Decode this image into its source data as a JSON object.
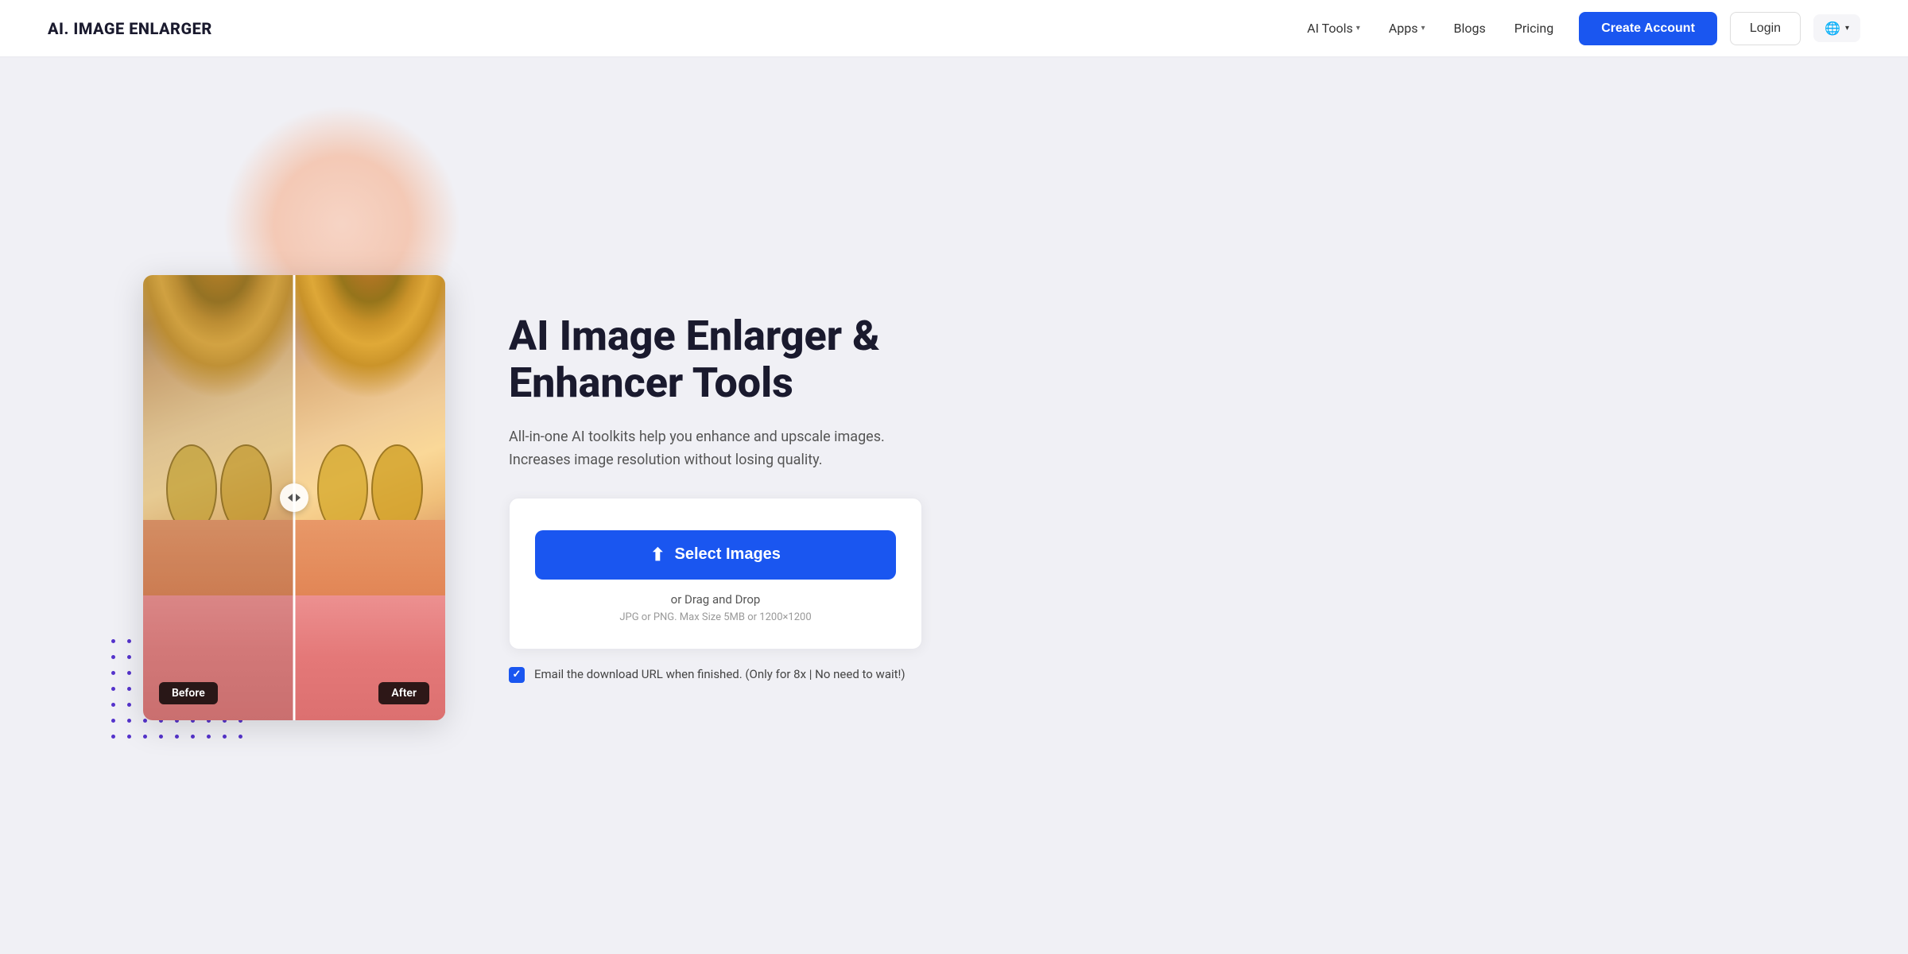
{
  "nav": {
    "logo": "AI. IMAGE ENLARGER",
    "links": [
      {
        "label": "AI Tools",
        "hasDropdown": true
      },
      {
        "label": "Apps",
        "hasDropdown": true
      },
      {
        "label": "Blogs",
        "hasDropdown": false
      },
      {
        "label": "Pricing",
        "hasDropdown": false
      }
    ],
    "cta_label": "Create Account",
    "login_label": "Login",
    "globe_label": "🌐"
  },
  "hero": {
    "title": "AI Image Enlarger & Enhancer Tools",
    "subtitle": "All-in-one AI toolkits help you enhance and upscale images. Increases image resolution without losing quality.",
    "upload": {
      "btn_label": "Select Images",
      "drag_label": "or Drag and Drop",
      "file_info": "JPG or PNG. Max Size 5MB or 1200×1200"
    },
    "email_notice": "Email the download URL when finished. (Only for 8x | No need to wait!)"
  },
  "compare": {
    "before_label": "Before",
    "after_label": "After"
  }
}
